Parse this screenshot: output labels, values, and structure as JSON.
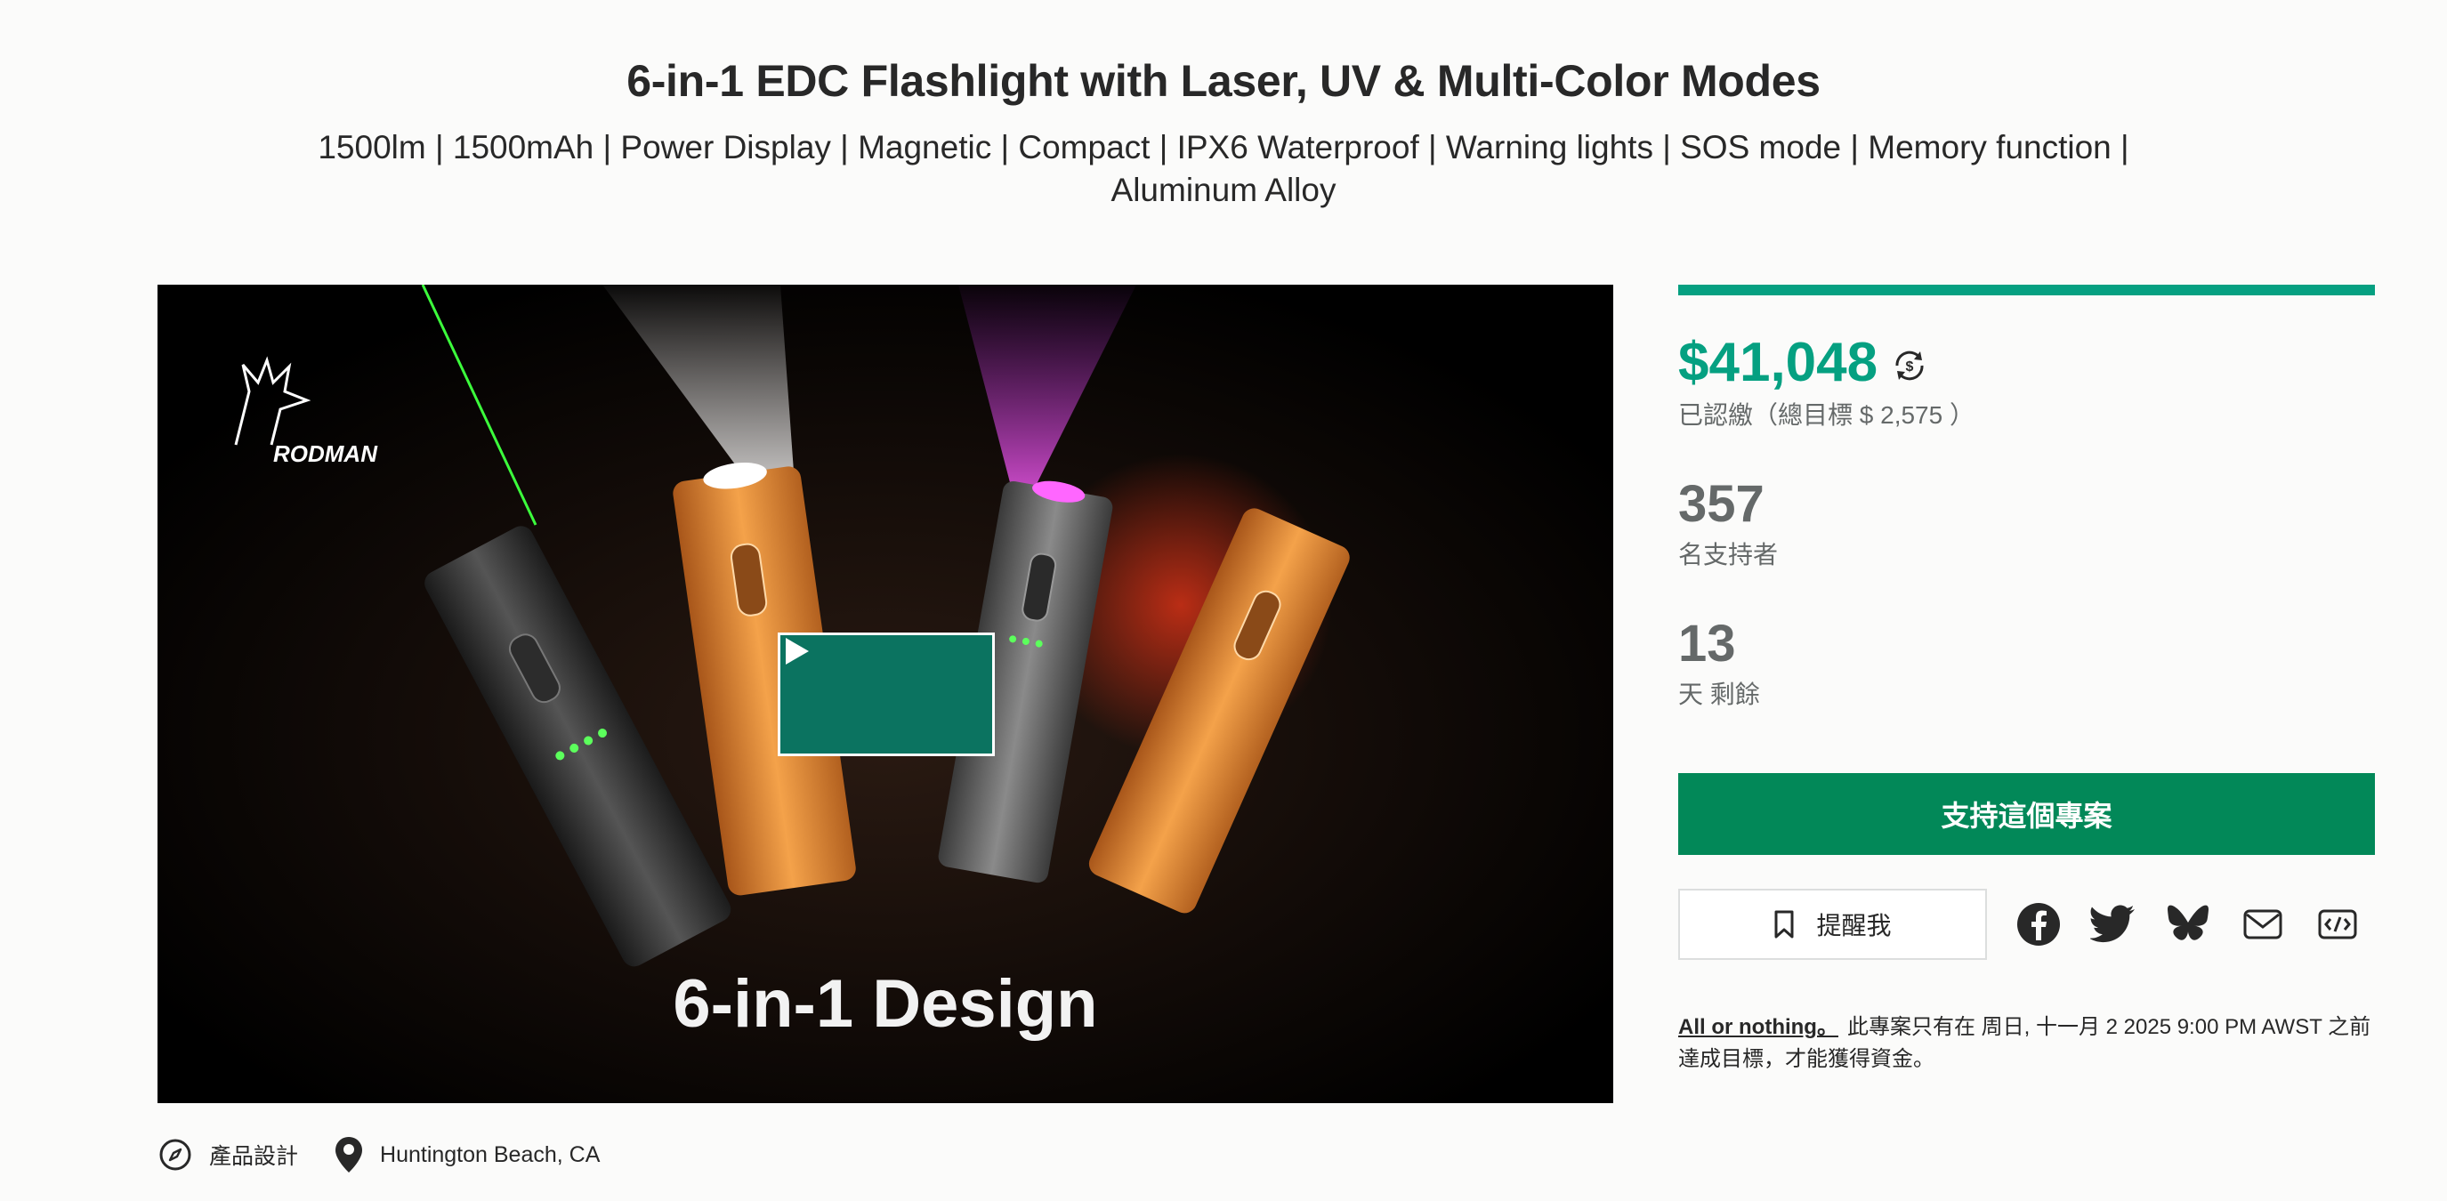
{
  "project": {
    "title": "6-in-1 EDC Flashlight with Laser, UV & Multi-Color Modes",
    "subtitle": "1500lm | 1500mAh | Power Display | Magnetic | Compact | IPX6 Waterproof | Warning lights | SOS mode | Memory function | Aluminum Alloy"
  },
  "video": {
    "overlay_text": "6-in-1 Design",
    "logo_text": "RODMAN",
    "play_icon": "play-icon"
  },
  "meta": {
    "category": "產品設計",
    "category_icon": "compass-icon",
    "location": "Huntington Beach, CA",
    "location_icon": "location-pin-icon"
  },
  "stats": {
    "funding_progress": 1.0,
    "pledged": "$41,048",
    "pledged_label": "已認繳（總目標 $ 2,575 ）",
    "backers": "357",
    "backers_label": "名支持者",
    "days_left": "13",
    "days_label": "天 剩餘"
  },
  "actions": {
    "back_button": "支持這個專案",
    "remind_button": "提醒我",
    "share_icons": [
      "facebook-icon",
      "twitter-icon",
      "bluesky-icon",
      "email-icon",
      "embed-icon"
    ]
  },
  "notice": {
    "link_text": "All or nothing。",
    "text": "此專案只有在 周日, 十一月 2 2025 9:00 PM AWST 之前達成目標，才能獲得資金。"
  },
  "colors": {
    "accent": "#05a081",
    "button": "#028858",
    "play_button": "#0b7360"
  }
}
